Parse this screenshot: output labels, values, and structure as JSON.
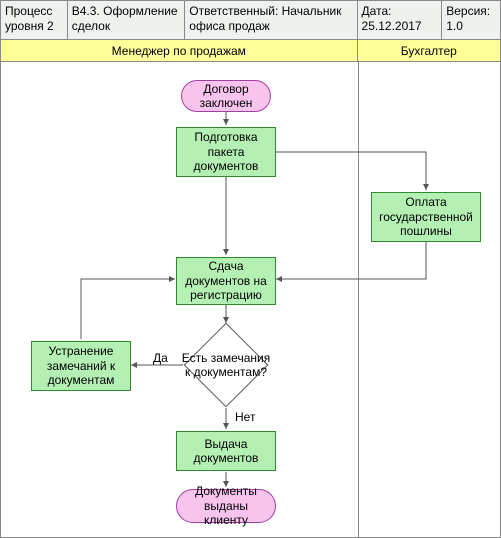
{
  "header": {
    "level_label": "Процесс уровня 2",
    "code": "В4.3.  Оформление сделок",
    "responsible": "Ответственный: Начальник офиса продаж",
    "date_label": "Дата:",
    "date_value": "25.12.2017",
    "version_label": "Версия:",
    "version_value": "1.0"
  },
  "lanes": {
    "manager": "Менеджер по продажам",
    "accountant": "Бухгалтер"
  },
  "nodes": {
    "start": "Договор заключен",
    "prepare": "Подготовка пакета документов",
    "pay_fee": "Оплата государственной пошлины",
    "submit": "Сдача документов на регистрацию",
    "decision": "Есть замечания к документам?",
    "fix": "Устранение замечаний к документам",
    "issue": "Выдача документов",
    "end": "Документы выданы клиенту"
  },
  "edges": {
    "yes": "Да",
    "no": "Нет"
  }
}
